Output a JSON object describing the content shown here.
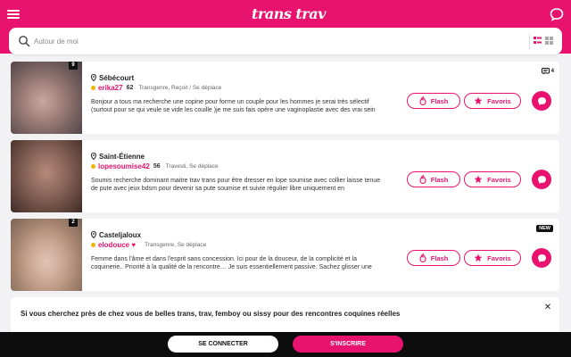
{
  "header": {
    "logo_text": "trans trav",
    "brand_color": "#e8136f",
    "menu_icon": "hamburger-icon",
    "chat_icon": "chat-bubble-icon"
  },
  "search": {
    "placeholder": "Autour de moi",
    "icon": "search-icon",
    "view_icons": [
      "list-view-icon",
      "grid-view-icon"
    ]
  },
  "profiles": [
    {
      "photo_count": "9",
      "location": "Sébécourt",
      "username": "erika27",
      "age": "62",
      "type": "Transgenre, Reçoit / Se déplace",
      "description": "Bonjour a tous ma recherche une copine pour forme un couple pour les hommes je serai très sélectif (surtout pour se qui veule se vide les couille )je me suis fais opère une vaginoplastie avec des vrai sein",
      "badge": "4",
      "badge_kind": "messages",
      "flash_label": "Flash",
      "fav_label": "Favoris"
    },
    {
      "photo_count": "",
      "location": "Saint-Étienne",
      "username": "lopesoumise42",
      "age": "56",
      "type": "Travesti, Se déplace",
      "description": "Soumis recherche dominant maitre trav trans pour être dresser en lope soumise avec collier laisse tenue de pute avec jeux bdsm pour devenir sa pute soumise et suivie régulier libre uniquement en",
      "badge": "",
      "badge_kind": "",
      "flash_label": "Flash",
      "fav_label": "Favoris"
    },
    {
      "photo_count": "2",
      "location": "Casteljaloux",
      "username": "elodouce ♥",
      "age": "",
      "type": "Transgenre, Se déplace",
      "description": "Femme dans l'âme et dans l'esprit sans concession. Ici pour de la douceur, de la complicité et la coquinerie.. Priorité à la qualité de la rencontre… Je suis essentiellement passive. Sachez glisser une",
      "badge": "NEW",
      "badge_kind": "new",
      "flash_label": "Flash",
      "fav_label": "Favoris"
    }
  ],
  "banner": {
    "title": "Si vous cherchez près de chez vous de belles trans, trav, femboy ou sissy pour des rencontres coquines réelles",
    "close_icon": "close-icon"
  },
  "footer": {
    "login_label": "SE CONNECTER",
    "signup_label": "S'INSCRIRE"
  }
}
